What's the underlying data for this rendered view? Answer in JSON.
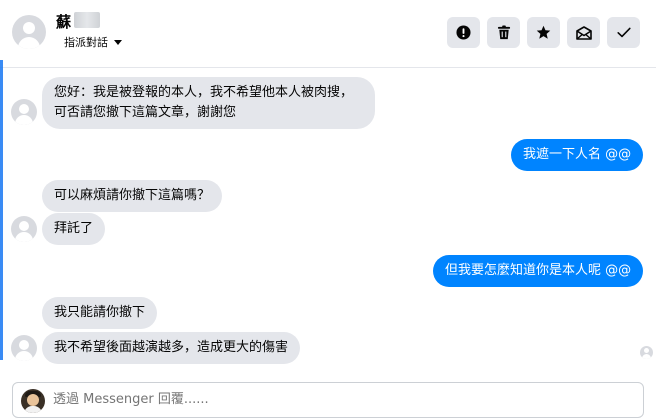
{
  "header": {
    "contact_name": "蘇",
    "assign_label": "指派對話",
    "actions": [
      {
        "name": "mark-spam",
        "icon": "exclamation-icon"
      },
      {
        "name": "delete",
        "icon": "trash-icon"
      },
      {
        "name": "star",
        "icon": "star-icon"
      },
      {
        "name": "mark-unread",
        "icon": "envelope-icon"
      },
      {
        "name": "mark-done",
        "icon": "check-icon"
      }
    ]
  },
  "messages": [
    {
      "side": "in",
      "text": "您好：我是被登報的本人，我不希望他本人被肉搜，可否請您撤下這篇文章，謝謝您"
    },
    {
      "side": "out",
      "text": "我遮一下人名 @@"
    },
    {
      "side": "in",
      "text": "可以麻煩請你撤下這篇嗎？"
    },
    {
      "side": "in",
      "text": "拜託了"
    },
    {
      "side": "out",
      "text": "但我要怎麼知道你是本人呢 @@"
    },
    {
      "side": "in",
      "text": "我只能請你撤下"
    },
    {
      "side": "in",
      "text": "我不希望後面越演越多，造成更大的傷害"
    }
  ],
  "composer": {
    "placeholder": "透過 Messenger 回覆......"
  },
  "colors": {
    "outgoing_bubble": "#0084ff",
    "incoming_bubble": "#e4e6eb",
    "action_button": "#e4e6eb"
  }
}
